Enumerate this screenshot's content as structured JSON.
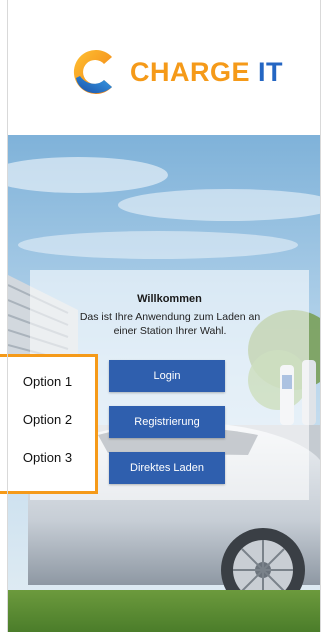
{
  "brand": {
    "name_main": "CHARGE",
    "name_accent": "IT",
    "colors": {
      "orange": "#f59a19",
      "blue": "#2466c3"
    }
  },
  "welcome": {
    "title": "Willkommen",
    "line1": "Das ist Ihre Anwendung zum Laden an",
    "line2": "einer Station Ihrer Wahl."
  },
  "buttons": {
    "login": "Login",
    "register": "Registrierung",
    "direct": "Direktes Laden",
    "color": "#2f5fae"
  },
  "options": [
    "Option 1",
    "Option 2",
    "Option 3"
  ],
  "icons": {
    "logo": "charge-it-c-logo-icon"
  }
}
